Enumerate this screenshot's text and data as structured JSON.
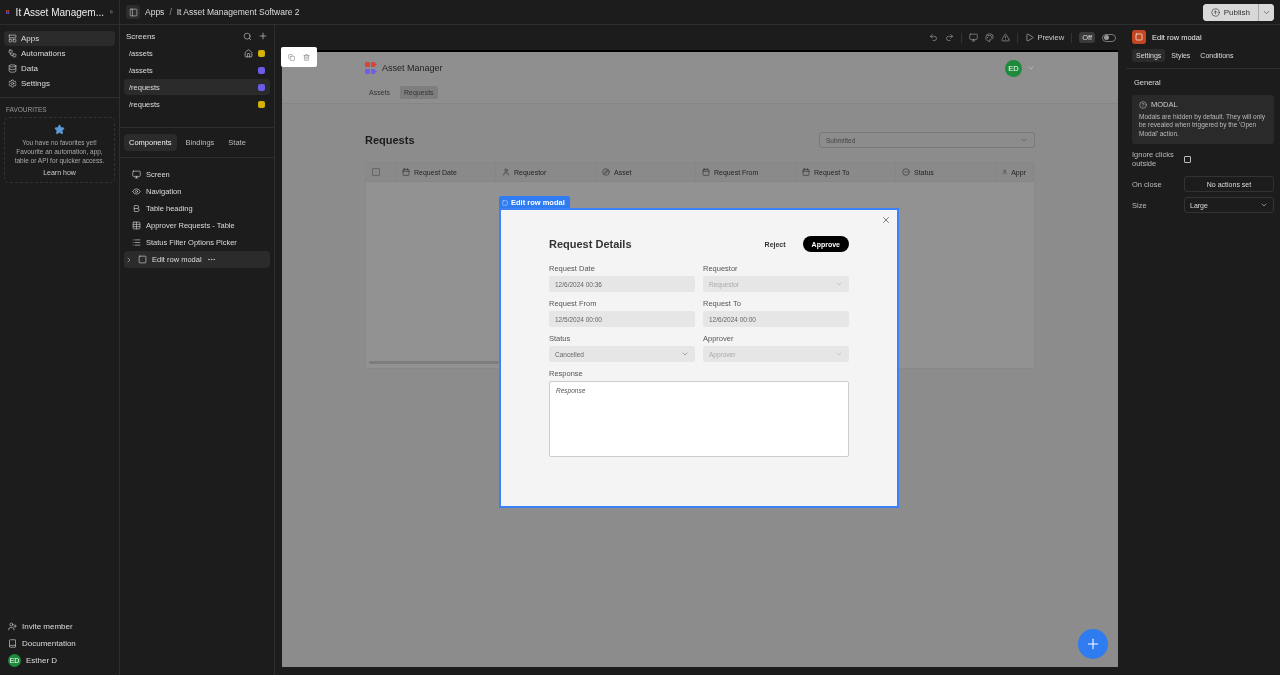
{
  "app": {
    "title": "It Asset Managem...",
    "nav": [
      {
        "label": "Apps",
        "selected": true
      },
      {
        "label": "Automations",
        "selected": false
      },
      {
        "label": "Data",
        "selected": false
      },
      {
        "label": "Settings",
        "selected": false
      }
    ],
    "favourites": {
      "heading": "FAVOURITES",
      "message": "You have no favorites yet! Favourite an automation, app, table or API for quicker access.",
      "link": "Learn how"
    },
    "footer": [
      {
        "kind": "invite",
        "label": "Invite member"
      },
      {
        "kind": "docs",
        "label": "Documentation"
      },
      {
        "kind": "user",
        "label": "Esther D",
        "initials": "ED"
      }
    ]
  },
  "breadcrumb": [
    "Apps",
    "It Asset Management Software 2"
  ],
  "breadcrumb_separator": "/",
  "publish": {
    "label": "Publish"
  },
  "screens": {
    "title": "Screens",
    "items": [
      {
        "path": "/assets",
        "home": true,
        "color": "#d4b106",
        "selected": false
      },
      {
        "path": "/assets",
        "home": false,
        "color": "#6b5ce7",
        "selected": false
      },
      {
        "path": "/requests",
        "home": false,
        "color": "#6b5ce7",
        "selected": true
      },
      {
        "path": "/requests",
        "home": false,
        "color": "#d4b106",
        "selected": false
      }
    ]
  },
  "component_tabs": [
    {
      "label": "Components",
      "selected": true
    },
    {
      "label": "Bindings",
      "selected": false
    },
    {
      "label": "State",
      "selected": false
    }
  ],
  "components": [
    {
      "kind": "screen",
      "label": "Screen",
      "selected": false,
      "expandable": false
    },
    {
      "kind": "navigation",
      "label": "Navigation",
      "selected": false,
      "expandable": false
    },
    {
      "kind": "heading",
      "label": "Table heading",
      "selected": false,
      "expandable": false
    },
    {
      "kind": "table",
      "label": "Approver Requests - Table",
      "selected": false,
      "expandable": false
    },
    {
      "kind": "picker",
      "label": "Status Filter Options Picker",
      "selected": false,
      "expandable": false
    },
    {
      "kind": "modal",
      "label": "Edit row modal",
      "selected": true,
      "expandable": true
    }
  ],
  "toolbar": {
    "preview": "Preview",
    "toggle": {
      "label": "Off",
      "on": false
    }
  },
  "preview": {
    "brand": "Asset Manager",
    "avatar": "ED",
    "tabs": [
      {
        "label": "Assets",
        "selected": false
      },
      {
        "label": "Requests",
        "selected": true
      }
    ],
    "heading": "Requests",
    "filter": "Submitted",
    "select_all": {
      "checked": false
    },
    "columns": [
      {
        "kind": "date",
        "label": "Request Date"
      },
      {
        "kind": "user",
        "label": "Requestor"
      },
      {
        "kind": "link",
        "label": "Asset"
      },
      {
        "kind": "date",
        "label": "Request From"
      },
      {
        "kind": "date",
        "label": "Request To"
      },
      {
        "kind": "option",
        "label": "Status"
      },
      {
        "kind": "user",
        "label": "Appr"
      }
    ]
  },
  "modal": {
    "tag": "Edit row modal",
    "title": "Request Details",
    "buttons": [
      {
        "kind": "secondary",
        "label": "Reject"
      },
      {
        "kind": "primary",
        "label": "Approve"
      }
    ],
    "fields": [
      {
        "kind": "text",
        "label": "Request Date",
        "value": "12/6/2024 00:36"
      },
      {
        "kind": "select",
        "label": "Requestor",
        "placeholder": "Requestor"
      },
      {
        "kind": "text",
        "label": "Request From",
        "value": "12/5/2024 00:00"
      },
      {
        "kind": "text",
        "label": "Request To",
        "value": "12/6/2024 00:00"
      },
      {
        "kind": "select",
        "label": "Status",
        "value": "Cancelled"
      },
      {
        "kind": "select",
        "label": "Approver",
        "placeholder": "Approver"
      }
    ],
    "response": {
      "label": "Response",
      "placeholder": "Response"
    }
  },
  "inspector": {
    "component": "Edit row modal",
    "tabs": [
      {
        "label": "Settings",
        "selected": true
      },
      {
        "label": "Styles",
        "selected": false
      },
      {
        "label": "Conditions",
        "selected": false
      }
    ],
    "section": "General",
    "info": {
      "title": "MODAL",
      "text": "Modals are hidden by default. They will only be revealed when triggered by the 'Open Modal' action."
    },
    "settings": [
      {
        "kind": "checkbox",
        "label": "Ignore clicks outside",
        "checked": false
      },
      {
        "kind": "button",
        "label": "On close",
        "value": "No actions set"
      },
      {
        "kind": "select",
        "label": "Size",
        "value": "Large"
      }
    ]
  }
}
